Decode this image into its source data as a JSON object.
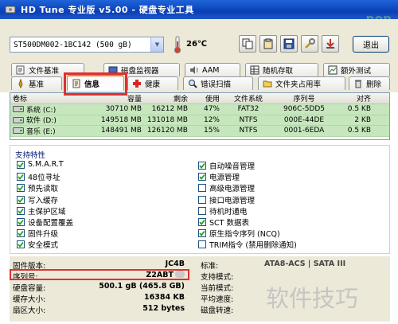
{
  "window": {
    "title": "HD Tune 专业版 v5.00 - 硬盘专业工具",
    "watermark_top": "pep"
  },
  "toolbar": {
    "drive": "ST500DM002-1BC142 (500 gB)",
    "temperature": "26℃",
    "exit_label": "退出"
  },
  "tabs_top": [
    {
      "label": "文件基准"
    },
    {
      "label": "磁盘监视器"
    },
    {
      "label": "AAM"
    },
    {
      "label": "随机存取"
    },
    {
      "label": "额外测试"
    }
  ],
  "tabs_bottom": [
    {
      "label": "基准"
    },
    {
      "label": "信息"
    },
    {
      "label": "健康"
    },
    {
      "label": "错误扫描"
    },
    {
      "label": "文件夹占用率"
    },
    {
      "label": "删除"
    }
  ],
  "table": {
    "headers": [
      "卷标",
      "容量",
      "剩余",
      "使用",
      "文件系统",
      "序列号",
      "对齐"
    ],
    "rows": [
      [
        "系统 (C:)",
        "30710 MB",
        "16212 MB",
        "47%",
        "FAT32",
        "906C-5DD5",
        "0.5 KB"
      ],
      [
        "软件 (D:)",
        "149518 MB",
        "131018 MB",
        "12%",
        "NTFS",
        "000E-44DE",
        "2 KB"
      ],
      [
        "音乐 (E:)",
        "148491 MB",
        "126120 MB",
        "15%",
        "NTFS",
        "0001-6EDA",
        "0.5 KB"
      ]
    ]
  },
  "features": {
    "title": "支持特性",
    "left": [
      {
        "label": "S.M.A.R.T",
        "checked": true
      },
      {
        "label": "48位寻址",
        "checked": true
      },
      {
        "label": "预先读取",
        "checked": true
      },
      {
        "label": "写入缓存",
        "checked": true
      },
      {
        "label": "主保护区域",
        "checked": true
      },
      {
        "label": "设备配置覆盖",
        "checked": true
      },
      {
        "label": "固件升级",
        "checked": true
      },
      {
        "label": "安全模式",
        "checked": true
      }
    ],
    "right": [
      {
        "label": "自动噪音管理",
        "checked": true
      },
      {
        "label": "电源管理",
        "checked": true
      },
      {
        "label": "高级电源管理",
        "checked": false
      },
      {
        "label": "接口电源管理",
        "checked": false
      },
      {
        "label": "待机时通电",
        "checked": false
      },
      {
        "label": "SCT 数据表",
        "checked": true
      },
      {
        "label": "原生指令序列 (NCQ)",
        "checked": true
      },
      {
        "label": "TRIM指令 (禁用删除通知)",
        "checked": false
      }
    ]
  },
  "info": {
    "left": [
      {
        "label": "固件版本:",
        "value": "JC4B"
      },
      {
        "label": "序列号:",
        "value": "Z2ABT"
      },
      {
        "label": "硬盘容量:",
        "value": "500.1 gB (465.8 GB)"
      },
      {
        "label": "缓存大小:",
        "value": "16384 KB"
      },
      {
        "label": "扇区大小:",
        "value": "512 bytes"
      }
    ],
    "right": [
      {
        "label": "标准:",
        "value": "ATA8-ACS | SATA III"
      },
      {
        "label": "支持模式:",
        "value": ""
      },
      {
        "label": "当前模式:",
        "value": ""
      },
      {
        "label": "平均速度:",
        "value": ""
      },
      {
        "label": "磁盘转速:",
        "value": ""
      }
    ]
  },
  "watermark": "软件技巧",
  "colors": {
    "titlebar": "#0a3fb5",
    "row_green": "#c6e7bd",
    "highlight": "#e03030",
    "tab_active_top": "#e68b2c"
  }
}
